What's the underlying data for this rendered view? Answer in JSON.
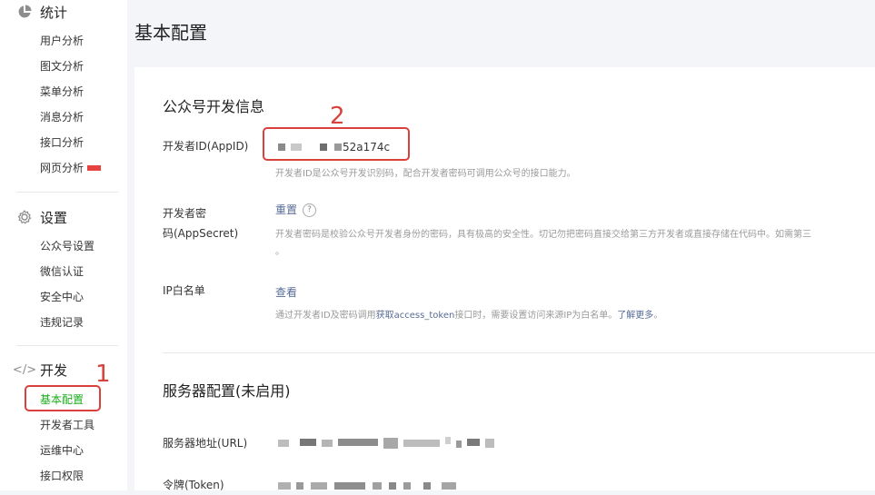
{
  "sidebar": {
    "stats": {
      "title": "统计",
      "icon": "pie-chart-icon",
      "items": [
        "用户分析",
        "图文分析",
        "菜单分析",
        "消息分析",
        "接口分析",
        "网页分析"
      ]
    },
    "settings": {
      "title": "设置",
      "icon": "gear-icon",
      "items": [
        "公众号设置",
        "微信认证",
        "安全中心",
        "违规记录"
      ]
    },
    "dev": {
      "title": "开发",
      "icon": "code-icon",
      "items": [
        "基本配置",
        "开发者工具",
        "运维中心",
        "接口权限"
      ],
      "active_index": 0
    }
  },
  "annotations": {
    "one": "1",
    "two": "2",
    "color": "#d9423c"
  },
  "page": {
    "title": "基本配置"
  },
  "dev_info": {
    "title": "公众号开发信息",
    "appid": {
      "label": "开发者ID(AppID)",
      "value_suffix": "52a174c",
      "desc": "开发者ID是公众号开发识别码，配合开发者密码可调用公众号的接口能力。"
    },
    "secret": {
      "label_line1": "开发者密",
      "label_line2": "码(AppSecret)",
      "action": "重置",
      "help": "?",
      "desc": "开发者密码是校验公众号开发者身份的密码，具有极高的安全性。切记勿把密码直接交给第三方开发者或直接存储在代码中。如需第三",
      "desc_end": "。"
    },
    "ip": {
      "label": "IP白名单",
      "action": "查看",
      "desc_prefix": "通过开发者ID及密码调用",
      "desc_link": "获取access_token",
      "desc_mid": "接口时，需要设置访问来源IP为白名单。",
      "desc_link2": "了解更多",
      "desc_end": "。"
    }
  },
  "server": {
    "title": "服务器配置(未启用)",
    "url_label": "服务器地址(URL)",
    "token_label": "令牌(Token)"
  },
  "colors": {
    "active": "#1aad19",
    "link": "#576b95",
    "annotation": "#d9423c"
  }
}
